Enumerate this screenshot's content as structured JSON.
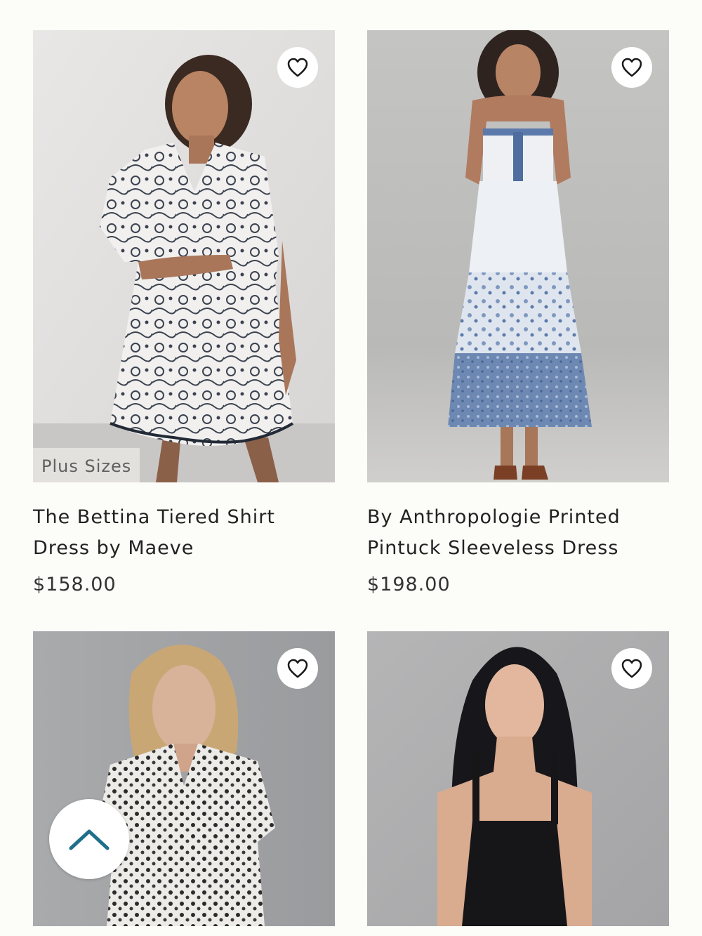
{
  "products": [
    {
      "title": "The Bettina Tiered Shirt Dress by Maeve",
      "price": "$158.00",
      "badge": "Plus Sizes"
    },
    {
      "title": "By Anthropologie Printed Pintuck Sleeveless Dress",
      "price": "$198.00"
    },
    {},
    {}
  ],
  "icons": {
    "favorite": "heart-outline-icon",
    "scroll_top": "chevron-up-icon"
  },
  "colors": {
    "background": "#fcfcf9",
    "scroll_top_chevron": "#1f6f8b",
    "badge_bg": "#e3e1dd"
  }
}
